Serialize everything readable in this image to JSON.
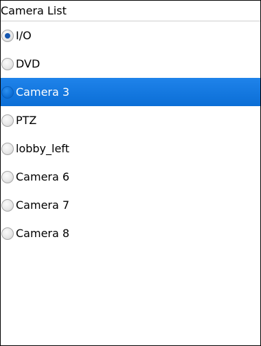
{
  "header": {
    "title": "Camera List"
  },
  "cameras": [
    {
      "label": "I/O",
      "checked": true,
      "highlighted": false
    },
    {
      "label": "DVD",
      "checked": false,
      "highlighted": false
    },
    {
      "label": "Camera 3",
      "checked": false,
      "highlighted": true
    },
    {
      "label": "PTZ",
      "checked": false,
      "highlighted": false
    },
    {
      "label": "lobby_left",
      "checked": false,
      "highlighted": false
    },
    {
      "label": "Camera 6",
      "checked": false,
      "highlighted": false
    },
    {
      "label": "Camera 7",
      "checked": false,
      "highlighted": false
    },
    {
      "label": "Camera 8",
      "checked": false,
      "highlighted": false
    }
  ],
  "colors": {
    "highlight": "#0b72dc",
    "radio_selected_dot": "#1557b0"
  }
}
